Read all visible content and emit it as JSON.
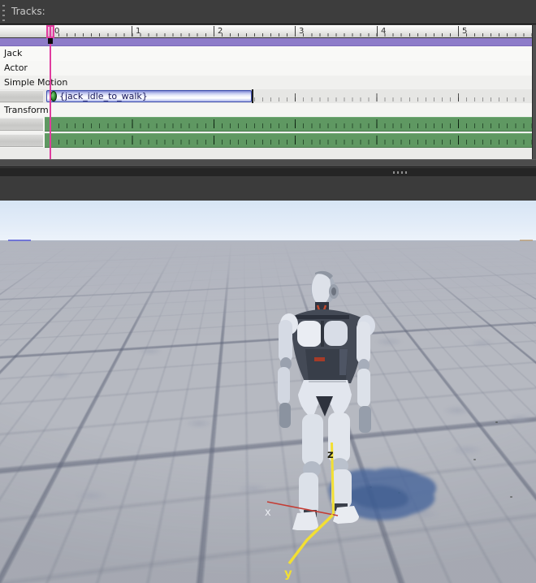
{
  "panel": {
    "title": "Tracks:"
  },
  "timeline": {
    "ruler_numbers": [
      "0",
      "1",
      "2",
      "3",
      "4",
      "5"
    ],
    "tracks": [
      {
        "label": "Jack"
      },
      {
        "label": "Actor"
      },
      {
        "label": "Simple Motion"
      },
      {
        "label": "Transform"
      }
    ],
    "clip": {
      "label": "{jack_idle_to_walk}"
    },
    "playhead_position": "0"
  },
  "viewport": {
    "axes": {
      "x": "x",
      "y": "y",
      "z": "z"
    }
  },
  "colors": {
    "playhead": "#e03c9e",
    "range_bar": "#8e7cc9",
    "clip_border": "#3f4fae",
    "clip_text": "#16165a",
    "keyframe_green": "#5f9862",
    "sky": "#d7e5f4",
    "floor": "#b6b9c1",
    "shadow": "#47659b",
    "axis_x_red": "#c43c34",
    "axis_yz_yellow": "#f2df33"
  }
}
